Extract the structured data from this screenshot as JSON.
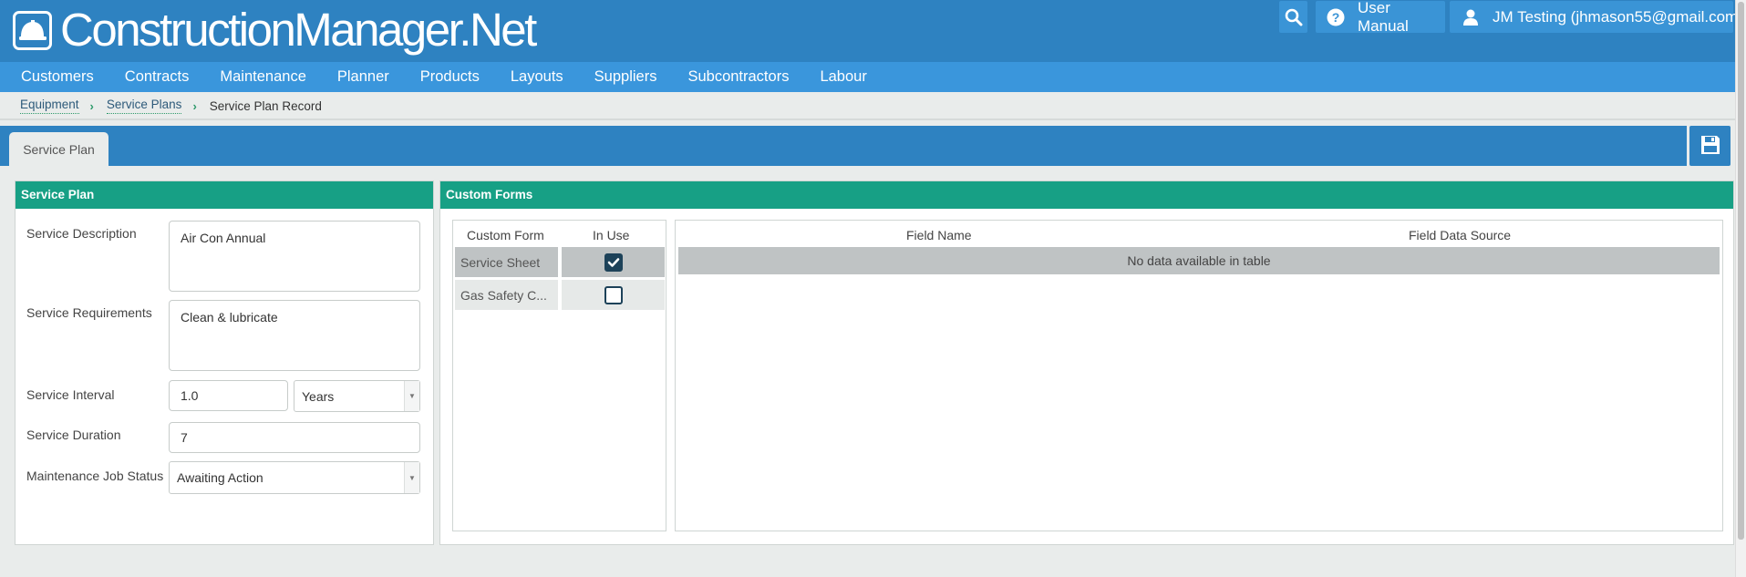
{
  "header": {
    "logo_text": "ConstructionManager.Net",
    "user_manual_label": "User Manual",
    "user_label": "JM Testing (jhmason55@gmail.com)"
  },
  "nav": {
    "items": [
      "Customers",
      "Contracts",
      "Maintenance",
      "Planner",
      "Products",
      "Layouts",
      "Suppliers",
      "Subcontractors",
      "Labour"
    ]
  },
  "breadcrumb": {
    "items": [
      "Equipment",
      "Service Plans"
    ],
    "current": "Service Plan Record"
  },
  "tabs": {
    "active": "Service Plan"
  },
  "service_plan": {
    "title": "Service Plan",
    "description_label": "Service Description",
    "description_value": "Air Con Annual",
    "requirements_label": "Service Requirements",
    "requirements_value": "Clean & lubricate",
    "interval_label": "Service Interval",
    "interval_value": "1.0",
    "interval_unit": "Years",
    "duration_label": "Service Duration",
    "duration_value": "7",
    "job_status_label": "Maintenance Job Status",
    "job_status_value": "Awaiting Action"
  },
  "custom_forms": {
    "title": "Custom Forms",
    "col_form": "Custom Form",
    "col_in_use": "In Use",
    "rows": [
      {
        "name": "Service Sheet",
        "in_use": true
      },
      {
        "name": "Gas Safety C...",
        "in_use": false
      }
    ],
    "fields_col_name": "Field Name",
    "fields_col_source": "Field Data Source",
    "empty_text": "No data available in table"
  },
  "icons": {
    "logo": "hard-hat-icon",
    "search": "search-icon",
    "help": "question-circle-icon",
    "user": "user-icon",
    "save": "floppy-disk-icon",
    "breadcrumb_separator": "chevron-right-icon"
  },
  "colors": {
    "header": "#2e82c1",
    "nav": "#3a96dc",
    "panel_header": "#17a085",
    "checkbox": "#1d4259"
  }
}
